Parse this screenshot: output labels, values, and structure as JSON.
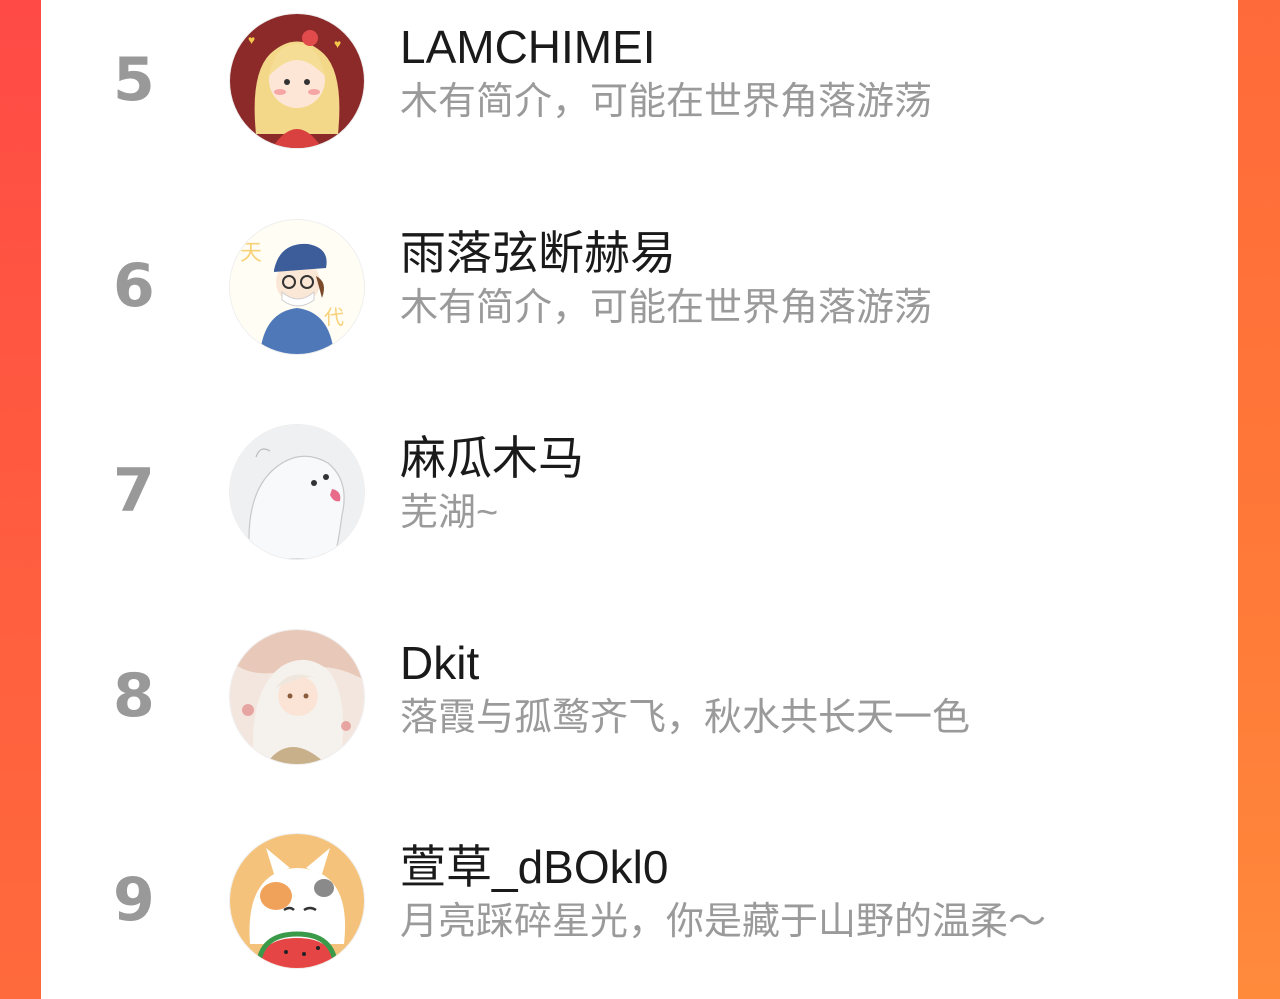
{
  "users": [
    {
      "rank": "5",
      "name": "LAMCHIMEI",
      "bio": "木有简介，可能在世界角落游荡",
      "avatar_icon": "girl-avatar-icon"
    },
    {
      "rank": "6",
      "name": "雨落弦断赫易",
      "bio": "木有简介，可能在世界角落游荡",
      "avatar_icon": "boy-with-cap-avatar-icon"
    },
    {
      "rank": "7",
      "name": "麻瓜木马",
      "bio": "芜湖~",
      "avatar_icon": "polar-bear-avatar-icon"
    },
    {
      "rank": "8",
      "name": "Dkit",
      "bio": "落霞与孤鹜齐飞，秋水共长天一色",
      "avatar_icon": "anime-character-avatar-icon"
    },
    {
      "rank": "9",
      "name": "萱草_dBOkl0",
      "bio": "月亮踩碎星光，你是藏于山野的温柔～",
      "avatar_icon": "cat-with-watermelon-avatar-icon"
    }
  ],
  "colors": {
    "background_left": "#ff4a46",
    "background_right": "#ff7a38",
    "card": "#ffffff",
    "rank_text": "#999999",
    "name_text": "#1a1a1a",
    "bio_text": "#9a9a9a"
  }
}
